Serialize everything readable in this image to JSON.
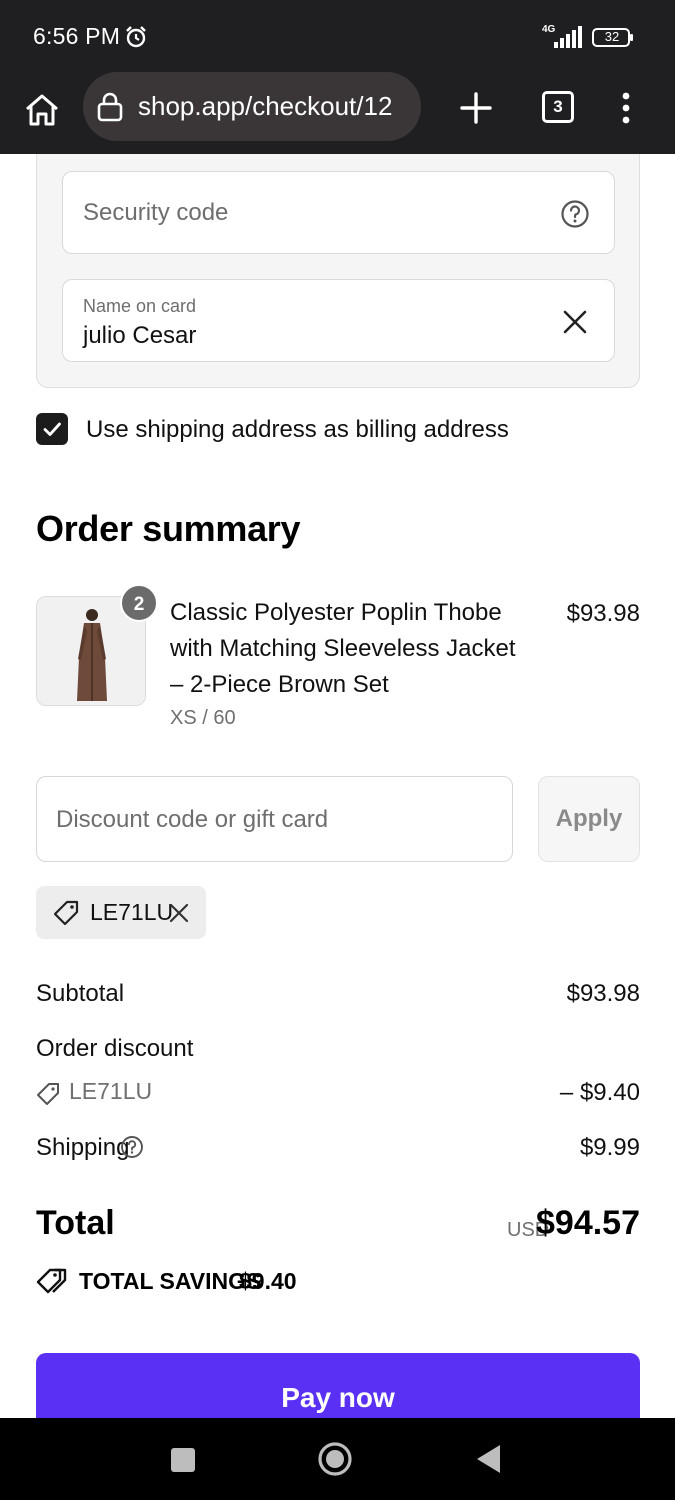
{
  "status_bar": {
    "time": "6:56 PM",
    "network": "4G",
    "battery": "32"
  },
  "browser": {
    "url": "shop.app/checkout/12",
    "tab_count": "3"
  },
  "payment": {
    "security_code_placeholder": "Security code",
    "name_on_card_label": "Name on card",
    "name_on_card_value": "julio Cesar"
  },
  "billing": {
    "checked": true,
    "label": "Use shipping address as billing address"
  },
  "order_summary": {
    "title": "Order summary",
    "item": {
      "quantity": "2",
      "title": "Classic Polyester Poplin Thobe with Matching Sleeveless Jacket – 2-Piece Brown Set",
      "variant": "XS / 60",
      "price": "$93.98"
    },
    "discount_placeholder": "Discount code or gift card",
    "apply_label": "Apply",
    "applied_code": "LE71LU",
    "subtotal_label": "Subtotal",
    "subtotal_value": "$93.98",
    "order_discount_label": "Order discount",
    "order_discount_code": "LE71LU",
    "order_discount_value": "– $9.40",
    "shipping_label": "Shipping",
    "shipping_value": "$9.99",
    "total_label": "Total",
    "total_currency": "USD",
    "total_value": "$94.57",
    "savings_label": "TOTAL SAVINGS",
    "savings_value": "$9.40",
    "pay_label": "Pay now"
  },
  "colors": {
    "pay_button": "#5a31f4",
    "chrome": "#1f1f21"
  }
}
